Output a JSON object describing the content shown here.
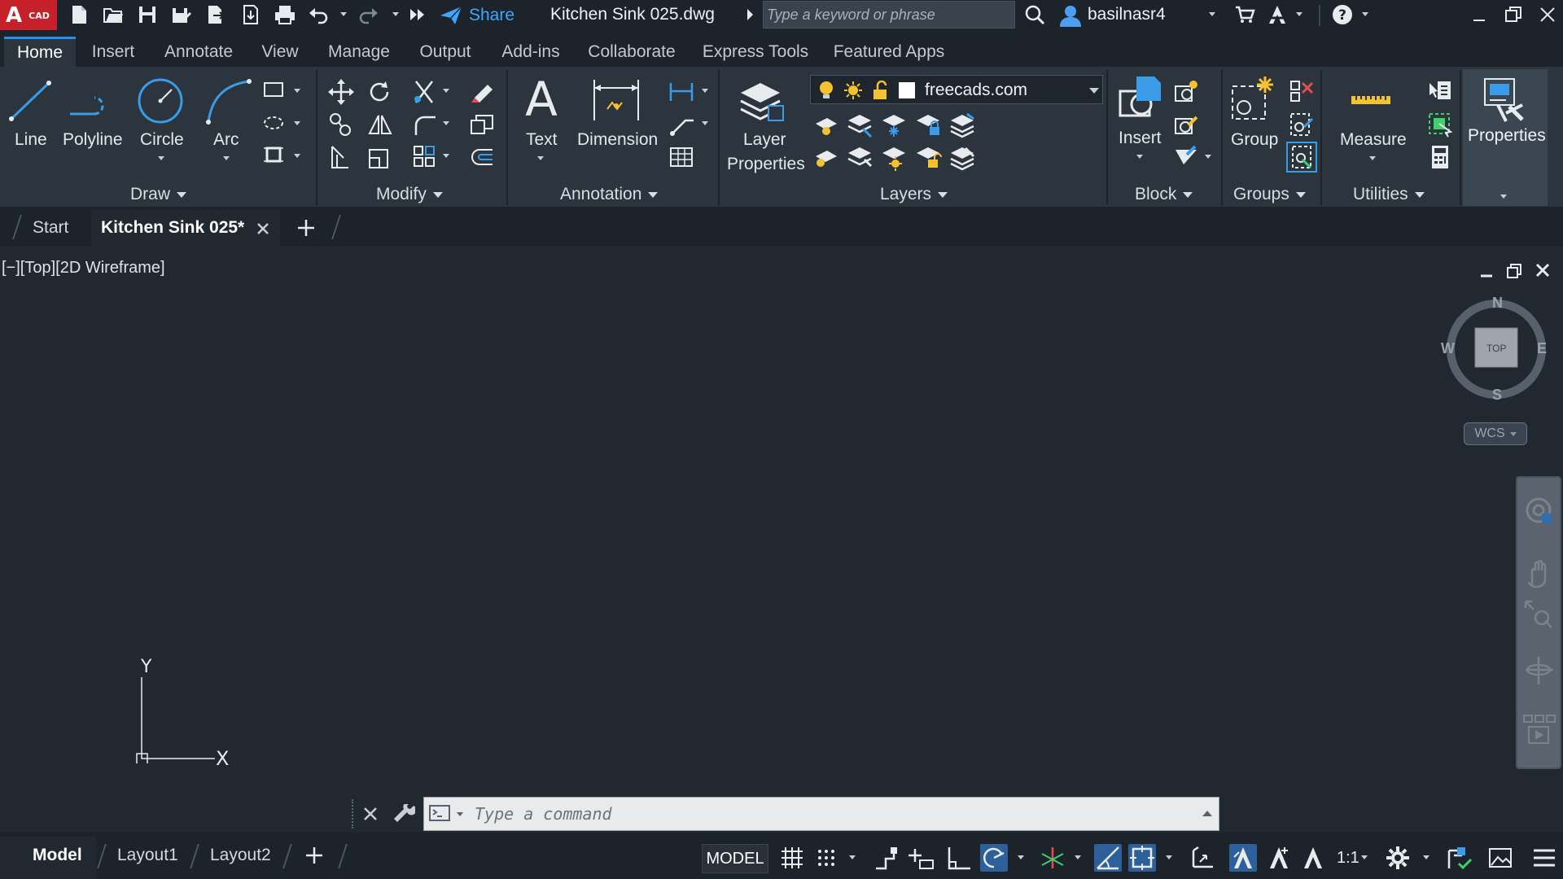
{
  "app": {
    "logo_letter": "A",
    "logo_sub": "CAD",
    "share_label": "Share",
    "doc_title": "Kitchen Sink 025.dwg",
    "user_name": "basilnasr4"
  },
  "search": {
    "placeholder": "Type a keyword or phrase"
  },
  "ribbon_tabs": [
    "Home",
    "Insert",
    "Annotate",
    "View",
    "Manage",
    "Output",
    "Add-ins",
    "Collaborate",
    "Express Tools",
    "Featured Apps"
  ],
  "ribbon": {
    "draw": {
      "title": "Draw",
      "line": "Line",
      "polyline": "Polyline",
      "circle": "Circle",
      "arc": "Arc"
    },
    "modify": {
      "title": "Modify"
    },
    "annotation": {
      "title": "Annotation",
      "text": "Text",
      "dimension": "Dimension"
    },
    "layers": {
      "title": "Layers",
      "layer_properties_1": "Layer",
      "layer_properties_2": "Properties",
      "current_layer": "freecads.com"
    },
    "block": {
      "title": "Block",
      "insert": "Insert"
    },
    "groups": {
      "title": "Groups",
      "group": "Group"
    },
    "utilities": {
      "title": "Utilities",
      "measure": "Measure"
    },
    "properties": {
      "label": "Properties"
    }
  },
  "doc_tabs": {
    "start": "Start",
    "active": "Kitchen Sink 025*"
  },
  "viewport": {
    "label": "[−][Top][2D Wireframe]",
    "ucs_x": "X",
    "ucs_y": "Y"
  },
  "viewcube": {
    "n": "N",
    "s": "S",
    "e": "E",
    "w": "W",
    "face": "TOP",
    "wcs": "WCS"
  },
  "command": {
    "placeholder": "Type a command"
  },
  "status": {
    "model_tab": "Model",
    "layout1": "Layout1",
    "layout2": "Layout2",
    "model_space": "MODEL",
    "scale": "1:1"
  },
  "colors": {
    "accent": "#2f8fe8",
    "logo": "#c6202a",
    "share": "#3da7ff",
    "icon_yellow": "#f2c230",
    "icon_blue": "#3a9ce8"
  }
}
